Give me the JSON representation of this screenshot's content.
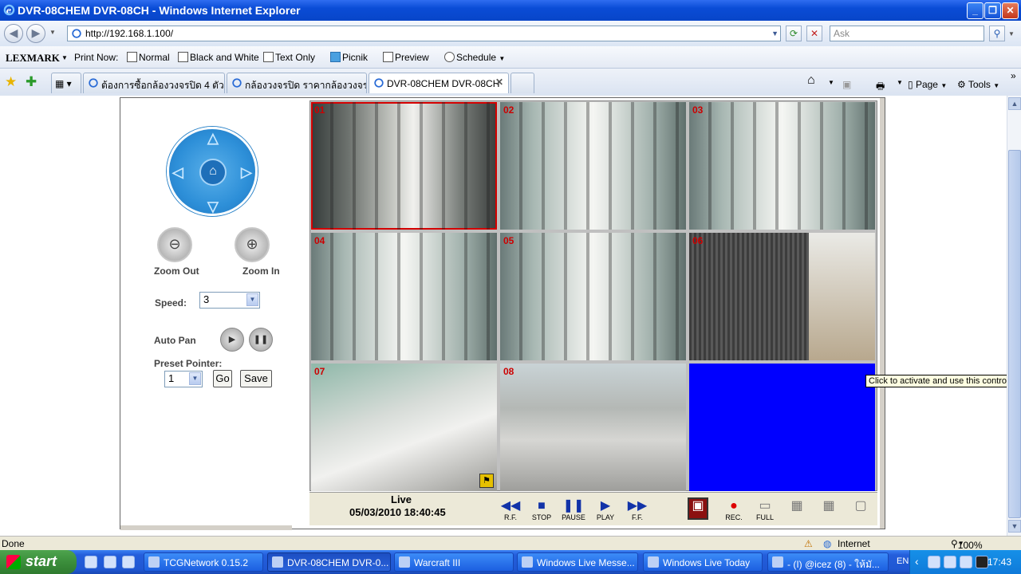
{
  "window": {
    "title": "DVR-08CHEM DVR-08CH - Windows Internet Explorer"
  },
  "address": {
    "url": "http://192.168.1.100/",
    "search_placeholder": "Ask"
  },
  "lexmark": {
    "brand": "LEXMARK",
    "print_now": "Print Now:",
    "normal": "Normal",
    "black_white": "Black and White",
    "text_only": "Text Only",
    "picnik": "Picnik",
    "preview": "Preview",
    "schedule": "Schedule"
  },
  "tabs": [
    {
      "label": "ต้องการซื้อกล้องวงจรปิด 4 ตัว ..."
    },
    {
      "label": "กล้องวงจรปิด ราคากล้องวงจรปิด"
    },
    {
      "label": "DVR-08CHEM DVR-08CH"
    }
  ],
  "commands": {
    "page": "Page",
    "tools": "Tools"
  },
  "ptz": {
    "zoom_out": "Zoom Out",
    "zoom_in": "Zoom In",
    "speed_label": "Speed:",
    "speed_value": "3",
    "auto_pan": "Auto Pan",
    "preset_label": "Preset Pointer:",
    "preset_value": "1",
    "go": "Go",
    "save": "Save"
  },
  "cameras": [
    {
      "num": "01"
    },
    {
      "num": "02"
    },
    {
      "num": "03"
    },
    {
      "num": "04"
    },
    {
      "num": "05"
    },
    {
      "num": "06"
    },
    {
      "num": "07"
    },
    {
      "num": "08"
    }
  ],
  "playback": {
    "mode": "Live",
    "datetime": "05/03/2010 18:40:45",
    "rf": "R.F.",
    "stop": "STOP",
    "pause": "PAUSE",
    "play": "PLAY",
    "ff": "F.F.",
    "rec": "REC.",
    "full": "FULL"
  },
  "tooltip": "Click to activate and use this control",
  "status": {
    "text": "Done",
    "zone": "Internet",
    "zoom": "100%"
  },
  "taskbar": {
    "start": "start",
    "items": [
      "TCGNetwork 0.15.2",
      "DVR-08CHEM DVR-0...",
      "Warcraft III",
      "Windows Live Messe...",
      "Windows Live Today",
      "- (I) @icez (8) - ให้มั..."
    ],
    "lang": "EN",
    "clock": "17:43"
  }
}
